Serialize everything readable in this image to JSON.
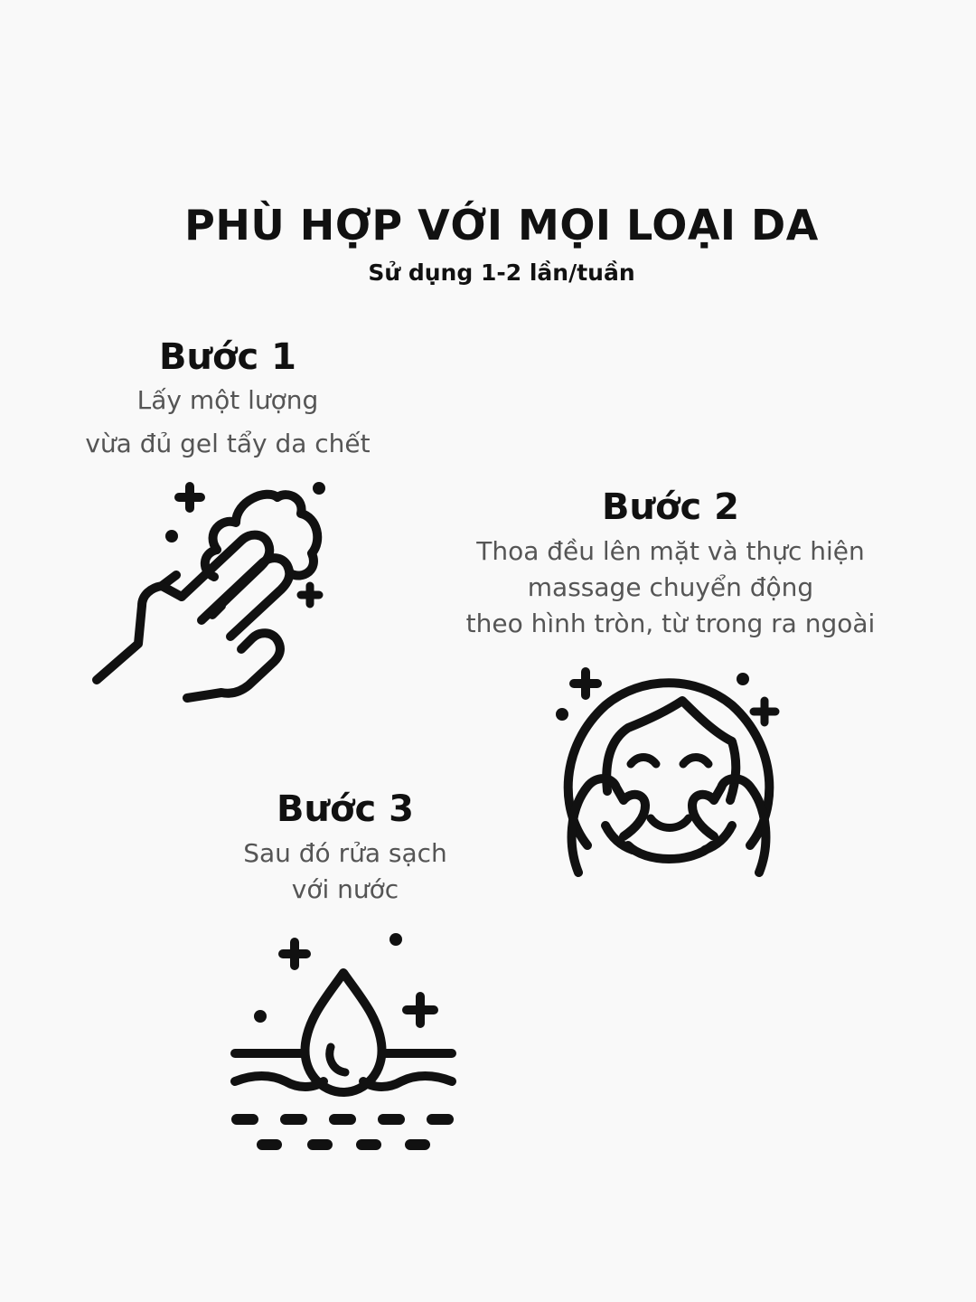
{
  "header": {
    "title": "PHÙ HỢP VỚI MỌI LOẠI DA",
    "subtitle": "Sử dụng 1-2 lần/tuần"
  },
  "steps": [
    {
      "title": "Bước 1",
      "description": [
        "Lấy một lượng",
        "vừa đủ gel tẩy da chết"
      ],
      "icon": "hand-foam-icon"
    },
    {
      "title": "Bước 2",
      "description": [
        "Thoa đều lên mặt và thực hiện",
        "massage chuyển động",
        "theo hình tròn, từ trong ra ngoài"
      ],
      "icon": "face-massage-icon"
    },
    {
      "title": "Bước 3",
      "description": [
        "Sau đó rửa sạch",
        "với nước"
      ],
      "icon": "water-drop-skin-icon"
    }
  ]
}
